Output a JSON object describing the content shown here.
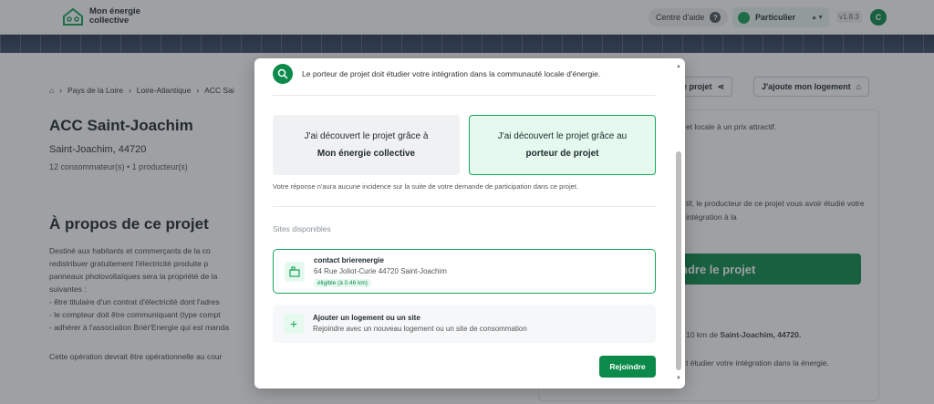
{
  "header": {
    "logo_line1": "Mon énergie",
    "logo_line2": "collective",
    "help_label": "Centre d'aide",
    "help_icon": "?",
    "profile_label": "Particulier",
    "version": "v1.8.3",
    "avatar_letter": "C"
  },
  "page": {
    "breadcrumb": [
      "Pays de la Loire",
      "Loire-Atlantique",
      "ACC Sai"
    ],
    "title": "ACC Saint-Joachim",
    "subtitle": "Saint-Joachim, 44720",
    "counts": "12 consommateur(s)  •  1 producteur(s)",
    "about_title": "À propos de ce projet",
    "about_lines": [
      "Destiné aux habitants et commerçants de la co",
      "redistribuer gratuitement l'électricité produite p",
      "panneaux photovoltaïques sera la propriété de la",
      "suivantes :",
      "- être titulaire d'un contrat d'électricité dont l'adres",
      "- le compteur doit être communiquant (type compt",
      "- adhérer à l'association Briér'Energie qui est manda"
    ],
    "about_foot": "Cette opération devrait être opérationnelle au cour",
    "share_label": "ce projet",
    "add_home_label": "J'ajoute mon logement",
    "side_text1": "et locale à un prix attractif.",
    "side_text2": "tif, le producteur de ce projet vous avoir étudié votre intégration à la",
    "join_label": "ndre le projet",
    "side_text3_prefix": "e 10 km de ",
    "side_text3_bold": "Saint-Joachim, 44720.",
    "side_text4": "t étudier votre intégration dans la énergie."
  },
  "modal": {
    "header_text": "Le porteur de projet doit étudier votre intégration dans la communauté locale d'énergie.",
    "choice_a_line1": "J'ai découvert le projet grâce à",
    "choice_a_line2": "Mon énergie collective",
    "choice_b_line1": "J'ai découvert le projet grâce au",
    "choice_b_line2": "porteur de projet",
    "note": "Votre réponse n'aura aucune incidence sur la suite de votre demande de participation dans ce projet.",
    "section_label": "Sites disponibles",
    "site": {
      "name": "contact brierenergie",
      "address": "64 Rue Joliot-Curie 44720 Saint-Joachim",
      "badge": "éligible (à 0.46 km)"
    },
    "add_site": {
      "title": "Ajouter un logement ou un site",
      "subtitle": "Rejoindre avec un nouveau logement ou un site de consommation"
    },
    "submit_label": "Rejoindre"
  },
  "colors": {
    "brand_green": "#0b8a4a",
    "accent_green": "#17a65a",
    "selected_bg": "#e6f9ee"
  }
}
